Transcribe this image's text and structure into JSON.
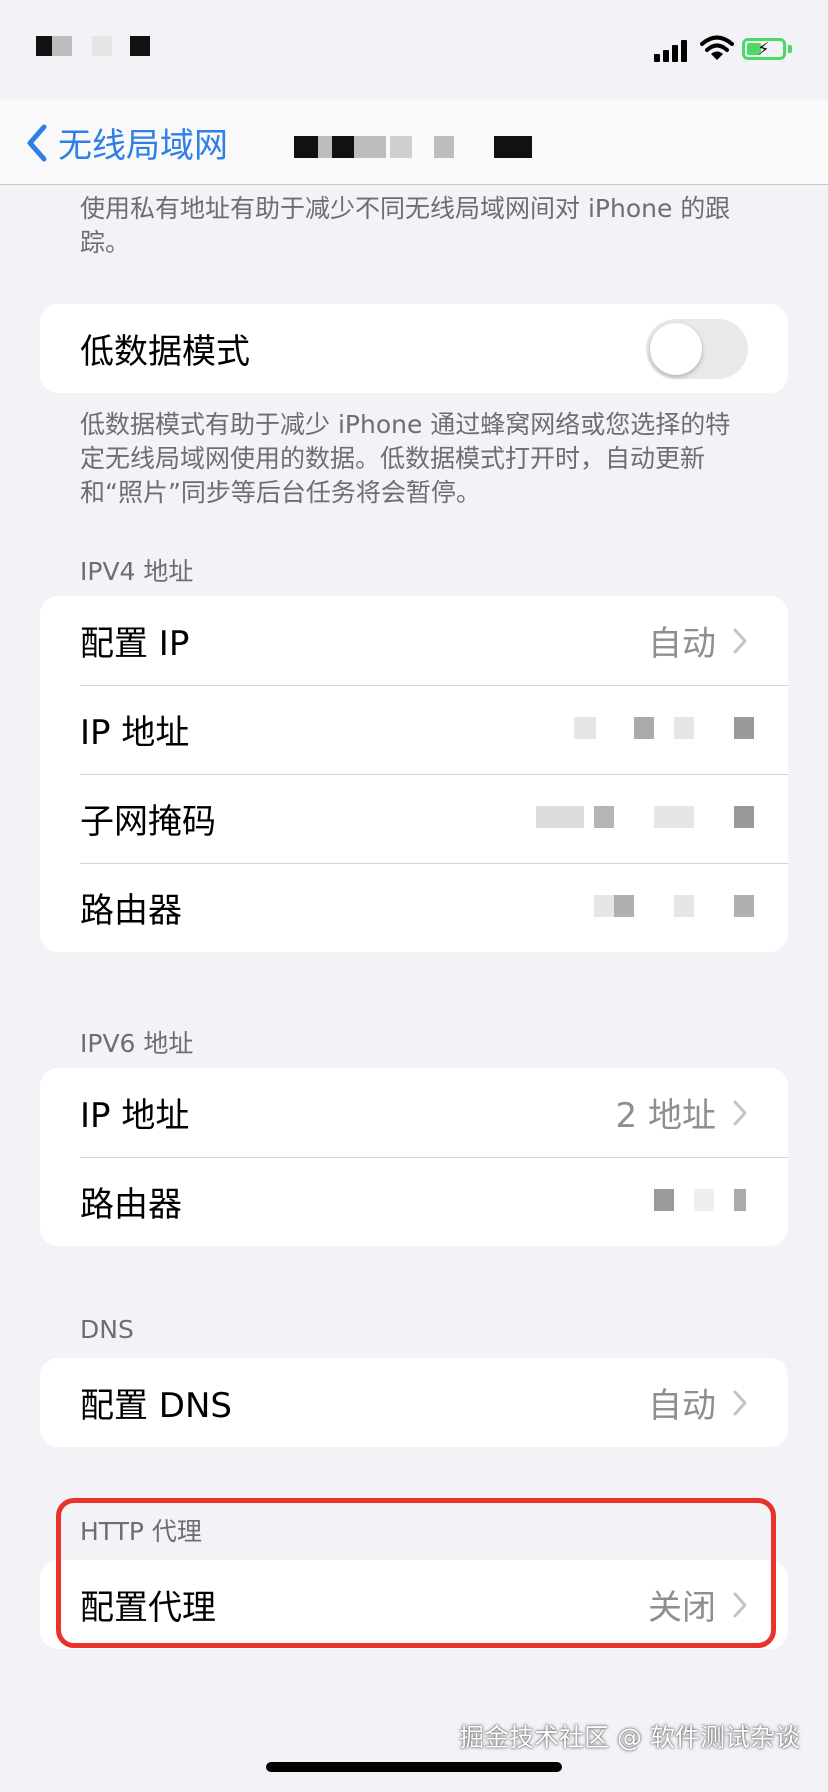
{
  "nav": {
    "back_label": "无线局域网"
  },
  "private_address_footer": "使用私有地址有助于减少不同无线局域网间对 iPhone 的跟踪。",
  "low_data": {
    "label": "低数据模式",
    "enabled": false,
    "footer": "低数据模式有助于减少 iPhone 通过蜂窝网络或您选择的特定无线局域网使用的数据。低数据模式打开时，自动更新和“照片”同步等后台任务将会暂停。"
  },
  "ipv4": {
    "header": "IPV4 地址",
    "rows": [
      {
        "label": "配置 IP",
        "value": "自动"
      },
      {
        "label": "IP 地址"
      },
      {
        "label": "子网掩码"
      },
      {
        "label": "路由器"
      }
    ]
  },
  "ipv6": {
    "header": "IPV6 地址",
    "rows": [
      {
        "label": "IP 地址",
        "value": "2 地址"
      },
      {
        "label": "路由器"
      }
    ]
  },
  "dns": {
    "header": "DNS",
    "rows": [
      {
        "label": "配置 DNS",
        "value": "自动"
      }
    ]
  },
  "proxy": {
    "header": "HTTP 代理",
    "rows": [
      {
        "label": "配置代理",
        "value": "关闭"
      }
    ]
  },
  "watermark": "掘金技术社区 @ 软件测试杂谈",
  "colors": {
    "accent": "#2f7fe6",
    "highlight": "#e8322a",
    "battery": "#4cd964"
  },
  "icons": [
    "cellular-signal-icon",
    "wifi-icon",
    "battery-charging-icon",
    "chevron-left-icon",
    "chevron-right-icon"
  ]
}
